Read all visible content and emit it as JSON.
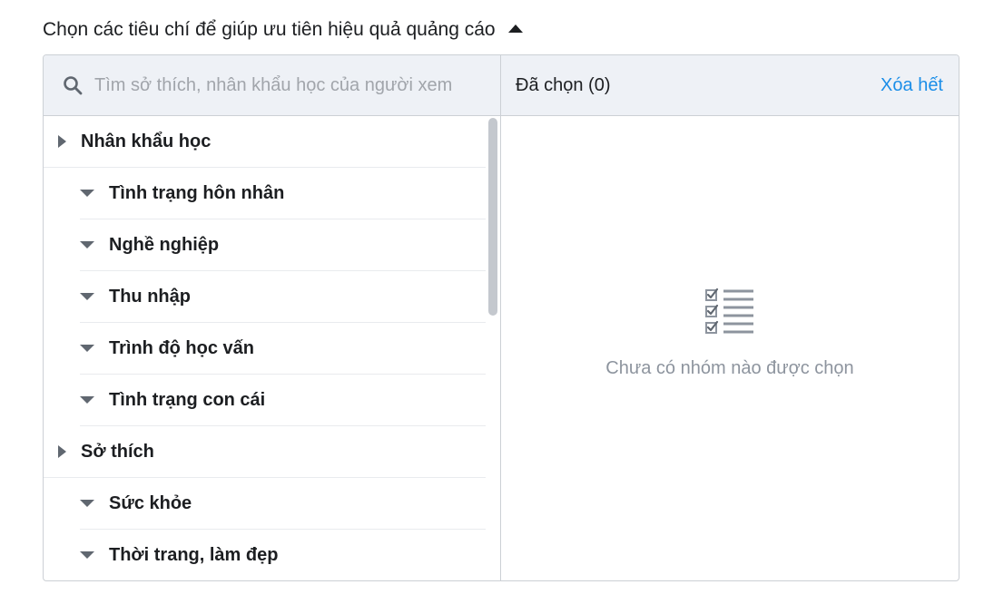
{
  "section": {
    "title": "Chọn các tiêu chí để giúp ưu tiên hiệu quả quảng cáo",
    "toggle_icon": "caret-up-icon"
  },
  "search": {
    "placeholder": "Tìm sở thích, nhân khẩu học của người xem",
    "value": "",
    "icon": "search-icon"
  },
  "selected": {
    "count_label": "Đã chọn (0)",
    "clear_label": "Xóa hết",
    "empty_text": "Chưa có nhóm nào được chọn",
    "empty_icon": "checklist-icon"
  },
  "tree": {
    "items": [
      {
        "label": "Nhân khẩu học",
        "level": 0
      },
      {
        "label": "Tình trạng hôn nhân",
        "level": 1
      },
      {
        "label": "Nghề nghiệp",
        "level": 1
      },
      {
        "label": "Thu nhập",
        "level": 1
      },
      {
        "label": "Trình độ học vấn",
        "level": 1
      },
      {
        "label": "Tình trạng con cái",
        "level": 1
      },
      {
        "label": "Sở thích",
        "level": 0
      },
      {
        "label": "Sức khỏe",
        "level": 1
      },
      {
        "label": "Thời trang, làm đẹp",
        "level": 1
      }
    ]
  },
  "colors": {
    "accent": "#1b8ee8",
    "header_bg": "#eef1f6",
    "border": "#ccd0d5",
    "muted_text": "#8d949e"
  }
}
